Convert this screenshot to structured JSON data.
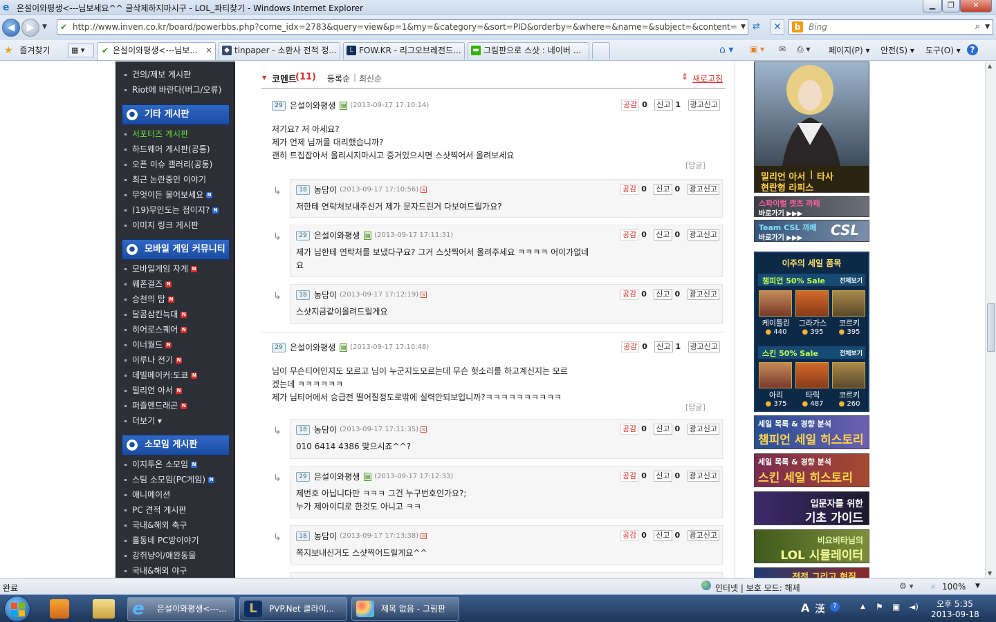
{
  "window": {
    "title": "은설이와평생<---님보세요^^ 글삭제하지마시구 - LOL_파티찾기 - Windows Internet Explorer"
  },
  "address": {
    "url": "http://www.inven.co.kr/board/powerbbs.php?come_idx=2783&query=view&p=1&my=&category=&sort=PID&orderby=&where=&name=&subject=&content=&keyword=&ster",
    "search_placeholder": "Bing"
  },
  "toolbar": {
    "favorites": "즐겨찾기",
    "page": "페이지(P)",
    "safety": "안전(S)",
    "tools": "도구(O)",
    "help": "?"
  },
  "tabs": [
    {
      "label": "은설이와평생<---님보...",
      "active": true
    },
    {
      "label": "tinpaper - 소환사 전적 정..."
    },
    {
      "label": "FOW.KR - 리그오브레전드..."
    },
    {
      "label": "그림판으로 스샷 : 네이버 ..."
    }
  ],
  "sidebar": {
    "top_items": [
      "건의/제보 게시판",
      "Riot에 바란다(버그/오류)"
    ],
    "sections": [
      {
        "title": "기타 게시판",
        "items": [
          {
            "label": "서포터즈 게시판",
            "selected": true
          },
          {
            "label": "하드웨어 게시판(공통)"
          },
          {
            "label": "오픈 이슈 갤러리(공통)"
          },
          {
            "label": "최근 논란중인 이야기"
          },
          {
            "label": "무엇이든 물어보세요",
            "badge": "N",
            "badge_color": "blue"
          },
          {
            "label": "(19)무인도는 첨이지?",
            "badge": "N",
            "badge_color": "blue"
          },
          {
            "label": "이미지 링크 게시판"
          }
        ]
      },
      {
        "title": "모바일 게임 커뮤니티",
        "items": [
          {
            "label": "모바일게임 자게",
            "badge": "N",
            "badge_color": "red"
          },
          {
            "label": "웨폰걸즈",
            "badge": "N",
            "badge_color": "red"
          },
          {
            "label": "승천의 탑",
            "badge": "N",
            "badge_color": "red"
          },
          {
            "label": "달콤삼킨늑대",
            "badge": "N",
            "badge_color": "red"
          },
          {
            "label": "히어로스퀘어",
            "badge": "N",
            "badge_color": "red"
          },
          {
            "label": "이너월드",
            "badge": "N",
            "badge_color": "red"
          },
          {
            "label": "이루나 전기",
            "badge": "N",
            "badge_color": "red"
          },
          {
            "label": "데빌메이커:도쿄",
            "badge": "N",
            "badge_color": "red"
          },
          {
            "label": "밀리언 아서",
            "badge": "N",
            "badge_color": "red"
          },
          {
            "label": "퍼즐앤드래곤",
            "badge": "N",
            "badge_color": "red"
          },
          {
            "label": "더보기 ▾"
          }
        ]
      },
      {
        "title": "소모임 게시판",
        "items": [
          {
            "label": "이지투온 소모임",
            "badge": "N",
            "badge_color": "blue"
          },
          {
            "label": "스팀 소모임(PC게임)",
            "badge": "N",
            "badge_color": "blue"
          },
          {
            "label": "애니메이션"
          },
          {
            "label": "PC 견적 게시판"
          },
          {
            "label": "국내&해외 축구"
          },
          {
            "label": "흘동네 PC방이야기"
          },
          {
            "label": "강쥐냥이/애완동물"
          },
          {
            "label": "국내&해외 야구"
          }
        ]
      }
    ]
  },
  "comments_header": {
    "title": "코멘트",
    "count": "(11)",
    "sort_reg": "등록순",
    "sort_new": "최신순",
    "refresh": "새로고침"
  },
  "labels": {
    "like": "공감",
    "report": "신고",
    "ad_report": "광고신고",
    "reply": "[답글]"
  },
  "comments": [
    {
      "level": "29",
      "author": "은설이와평생",
      "date": "(2013-09-17 17:10:14)",
      "likes": "0",
      "reports": "1",
      "text": "저기요? 저 아세요?\n제가 언제 님꺼를 대리했습니까?\n괜히 트집잡아서 올리시지마시고 증거있으시면 스샷찍어서 올려보세요",
      "replies": [
        {
          "level": "18",
          "author": "농담이",
          "date": "(2013-09-17 17:10:56)",
          "likes": "0",
          "reports": "0",
          "text": "저한테 연락처보내주신거 제가 문자드린거 다보여드릴가요?"
        },
        {
          "level": "29",
          "author": "은설이와평생",
          "date": "(2013-09-17 17:11:31)",
          "likes": "0",
          "reports": "0",
          "text": "제가 님한테 연락처를 보냈다구요? 그거 스샷찍어서 올려주세요 ㅋㅋㅋㅋ 어이가없네\n요"
        },
        {
          "level": "18",
          "author": "농담이",
          "date": "(2013-09-17 17:12:19)",
          "likes": "0",
          "reports": "0",
          "text": "스샷지금같이올려드릴게요"
        }
      ]
    },
    {
      "level": "29",
      "author": "은설이와평생",
      "date": "(2013-09-17 17:10:48)",
      "likes": "0",
      "reports": "1",
      "text": "님이 무슨티어인지도 모르고 님이 누군지도모르는데 무슨 헛소리를 하고계신지는 모르\n겠는데 ㅋㅋㅋㅋㅋㅋ\n제가 님티어에서 승급전 떨어질정도로밖에 실력안되보입니까?ㅋㅋㅋㅋㅋㅋㅋㅋㅋㅋ",
      "replies": [
        {
          "level": "18",
          "author": "농담이",
          "date": "(2013-09-17 17:11:35)",
          "likes": "0",
          "reports": "0",
          "text": "010 6414 4386 맞으시죠^^?"
        },
        {
          "level": "29",
          "author": "은설이와평생",
          "date": "(2013-09-17 17:12:33)",
          "likes": "0",
          "reports": "0",
          "text": "제번호 아닙니다만 ㅋㅋㅋ 그건 누구번호인가요?;\n누가 제아이디로 한것도 아니고 ㅋㅋ"
        },
        {
          "level": "18",
          "author": "농담이",
          "date": "(2013-09-17 17:13:38)",
          "likes": "0",
          "reports": "0",
          "text": "쪽지보내신거도 스샷찍어드릴게요^^"
        }
      ]
    }
  ],
  "right": {
    "ad_top_caption_1": "밀리언 아서",
    "ad_top_caption_2": "타사",
    "ad_top_caption_3": "현란형 라피스",
    "spiral_title": "스파이럴 캣츠 까페",
    "spiral_go": "바로가기 ▶▶▶",
    "csl_title": "Team CSL 까페",
    "csl_go": "바로가기 ▶▶▶",
    "csl_logo": "CSL",
    "sale_title": "이주의 세일 품목",
    "champ_sale": "챔피언 50% Sale",
    "skin_sale": "스킨 50% Sale",
    "view_all": "전체보기",
    "champs": [
      {
        "name": "케이틀린",
        "price": "440"
      },
      {
        "name": "그라가스",
        "price": "395"
      },
      {
        "name": "코르키",
        "price": "395"
      }
    ],
    "skins": [
      {
        "name": "아리",
        "price": "375"
      },
      {
        "name": "타릭",
        "price": "487"
      },
      {
        "name": "코르키",
        "price": "260"
      }
    ],
    "b1_small": "세일 목록 & 경향 분석",
    "b1_big": "챔피언 세일 히스토리",
    "b2_small": "세일 목록 & 경향 분석",
    "b2_big": "스킨 세일 히스토리",
    "b3_small": "입문자를 위한",
    "b3_big": "기초 가이드",
    "b4_small": "비요비타님의",
    "b4_big": "LOL 시뮬레이터",
    "b5_big": "전적 그리고 현질"
  },
  "status": {
    "left": "완료",
    "zone": "인터넷 | 보호 모드: 해제",
    "zoom": "100%"
  },
  "taskbar": {
    "items": [
      "은설이와평생<---...",
      "PVP.Net 클라이...",
      "제목 없음 - 그림판"
    ],
    "time": "오후 5:35",
    "date": "2013-09-18",
    "ime_a": "A",
    "ime_han": "漢"
  }
}
